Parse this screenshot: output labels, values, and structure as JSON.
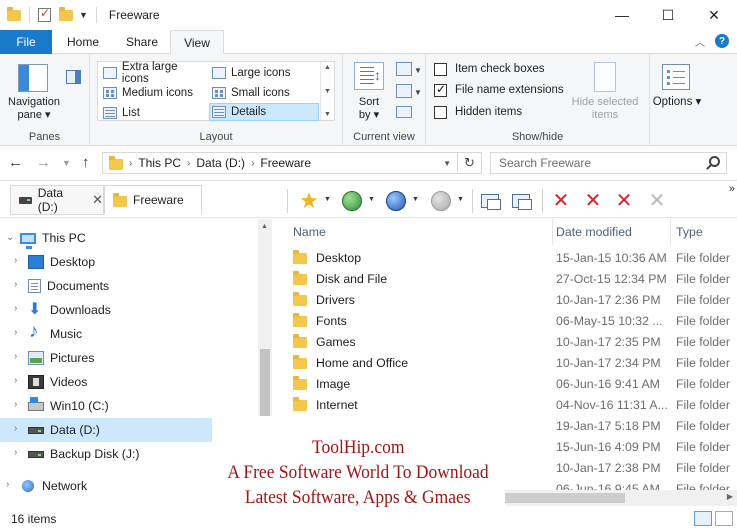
{
  "window": {
    "title": "Freeware",
    "controls": {
      "minimize": "—",
      "maximize": "☐",
      "close": "✕"
    }
  },
  "ribbon_tabs": {
    "file": "File",
    "home": "Home",
    "share": "Share",
    "view": "View",
    "active": "View"
  },
  "ribbon": {
    "panes": {
      "navigation_pane": "Navigation pane ▾",
      "group_label": "Panes"
    },
    "layout": {
      "items": [
        "Extra large icons",
        "Large icons",
        "Medium icons",
        "Small icons",
        "List",
        "Details"
      ],
      "selected": "Details",
      "group_label": "Layout"
    },
    "current_view": {
      "sort_by": "Sort by ▾",
      "group_label": "Current view"
    },
    "show_hide": {
      "item_check_boxes": {
        "label": "Item check boxes",
        "checked": false
      },
      "file_name_extensions": {
        "label": "File name extensions",
        "checked": true
      },
      "hidden_items": {
        "label": "Hidden items",
        "checked": false
      },
      "hide_selected_items": "Hide selected items",
      "group_label": "Show/hide"
    },
    "options": {
      "label": "Options ▾"
    }
  },
  "address": {
    "path": [
      "This PC",
      "Data (D:)",
      "Freeware"
    ],
    "search_placeholder": "Search Freeware"
  },
  "folder_tabs": [
    {
      "label": "Data (D:)",
      "icon": "drive-icon",
      "active": false
    },
    {
      "label": "Freeware",
      "icon": "folder-icon",
      "active": true
    }
  ],
  "nav_pane": {
    "items": [
      {
        "label": "This PC",
        "icon": "computer-icon",
        "level": 0,
        "expanded": true
      },
      {
        "label": "Desktop",
        "icon": "desktop-icon",
        "level": 1
      },
      {
        "label": "Documents",
        "icon": "documents-icon",
        "level": 1
      },
      {
        "label": "Downloads",
        "icon": "downloads-icon",
        "level": 1
      },
      {
        "label": "Music",
        "icon": "music-icon",
        "level": 1
      },
      {
        "label": "Pictures",
        "icon": "pictures-icon",
        "level": 1
      },
      {
        "label": "Videos",
        "icon": "videos-icon",
        "level": 1
      },
      {
        "label": "Win10 (C:)",
        "icon": "system-drive-icon",
        "level": 1
      },
      {
        "label": "Data (D:)",
        "icon": "drive-icon",
        "level": 1,
        "selected": true
      },
      {
        "label": "Backup Disk (J:)",
        "icon": "drive-icon",
        "level": 1
      },
      {
        "label": "Network",
        "icon": "network-icon",
        "level": 0
      }
    ]
  },
  "file_list": {
    "columns": [
      "Name",
      "Date modified",
      "Type"
    ],
    "rows": [
      {
        "name": "Desktop",
        "date": "15-Jan-15 10:36 AM",
        "type": "File folder"
      },
      {
        "name": "Disk and File",
        "date": "27-Oct-15 12:34 PM",
        "type": "File folder"
      },
      {
        "name": "Drivers",
        "date": "10-Jan-17 2:36 PM",
        "type": "File folder"
      },
      {
        "name": "Fonts",
        "date": "06-May-15 10:32 ...",
        "type": "File folder"
      },
      {
        "name": "Games",
        "date": "10-Jan-17 2:35 PM",
        "type": "File folder"
      },
      {
        "name": "Home and Office",
        "date": "10-Jan-17 2:34 PM",
        "type": "File folder"
      },
      {
        "name": "Image",
        "date": "06-Jun-16 9:41 AM",
        "type": "File folder"
      },
      {
        "name": "Internet",
        "date": "04-Nov-16 11:31 A...",
        "type": "File folder"
      },
      {
        "name": "",
        "date": "19-Jan-17 5:18 PM",
        "type": "File folder"
      },
      {
        "name": "",
        "date": "15-Jun-16 4:09 PM",
        "type": "File folder"
      },
      {
        "name": "",
        "date": "10-Jan-17 2:38 PM",
        "type": "File folder"
      },
      {
        "name": "",
        "date": "06-Jun-16 9:45 AM",
        "type": "File folder"
      }
    ]
  },
  "status": {
    "item_count": "16 items"
  },
  "watermark": {
    "line1": "ToolHip.com",
    "line2": "A Free Software World To Download",
    "line3": "Latest Software, Apps & Gmaes"
  },
  "colors": {
    "accent": "#1979ca",
    "selection": "#cce8ff",
    "folder": "#f3c74c"
  }
}
